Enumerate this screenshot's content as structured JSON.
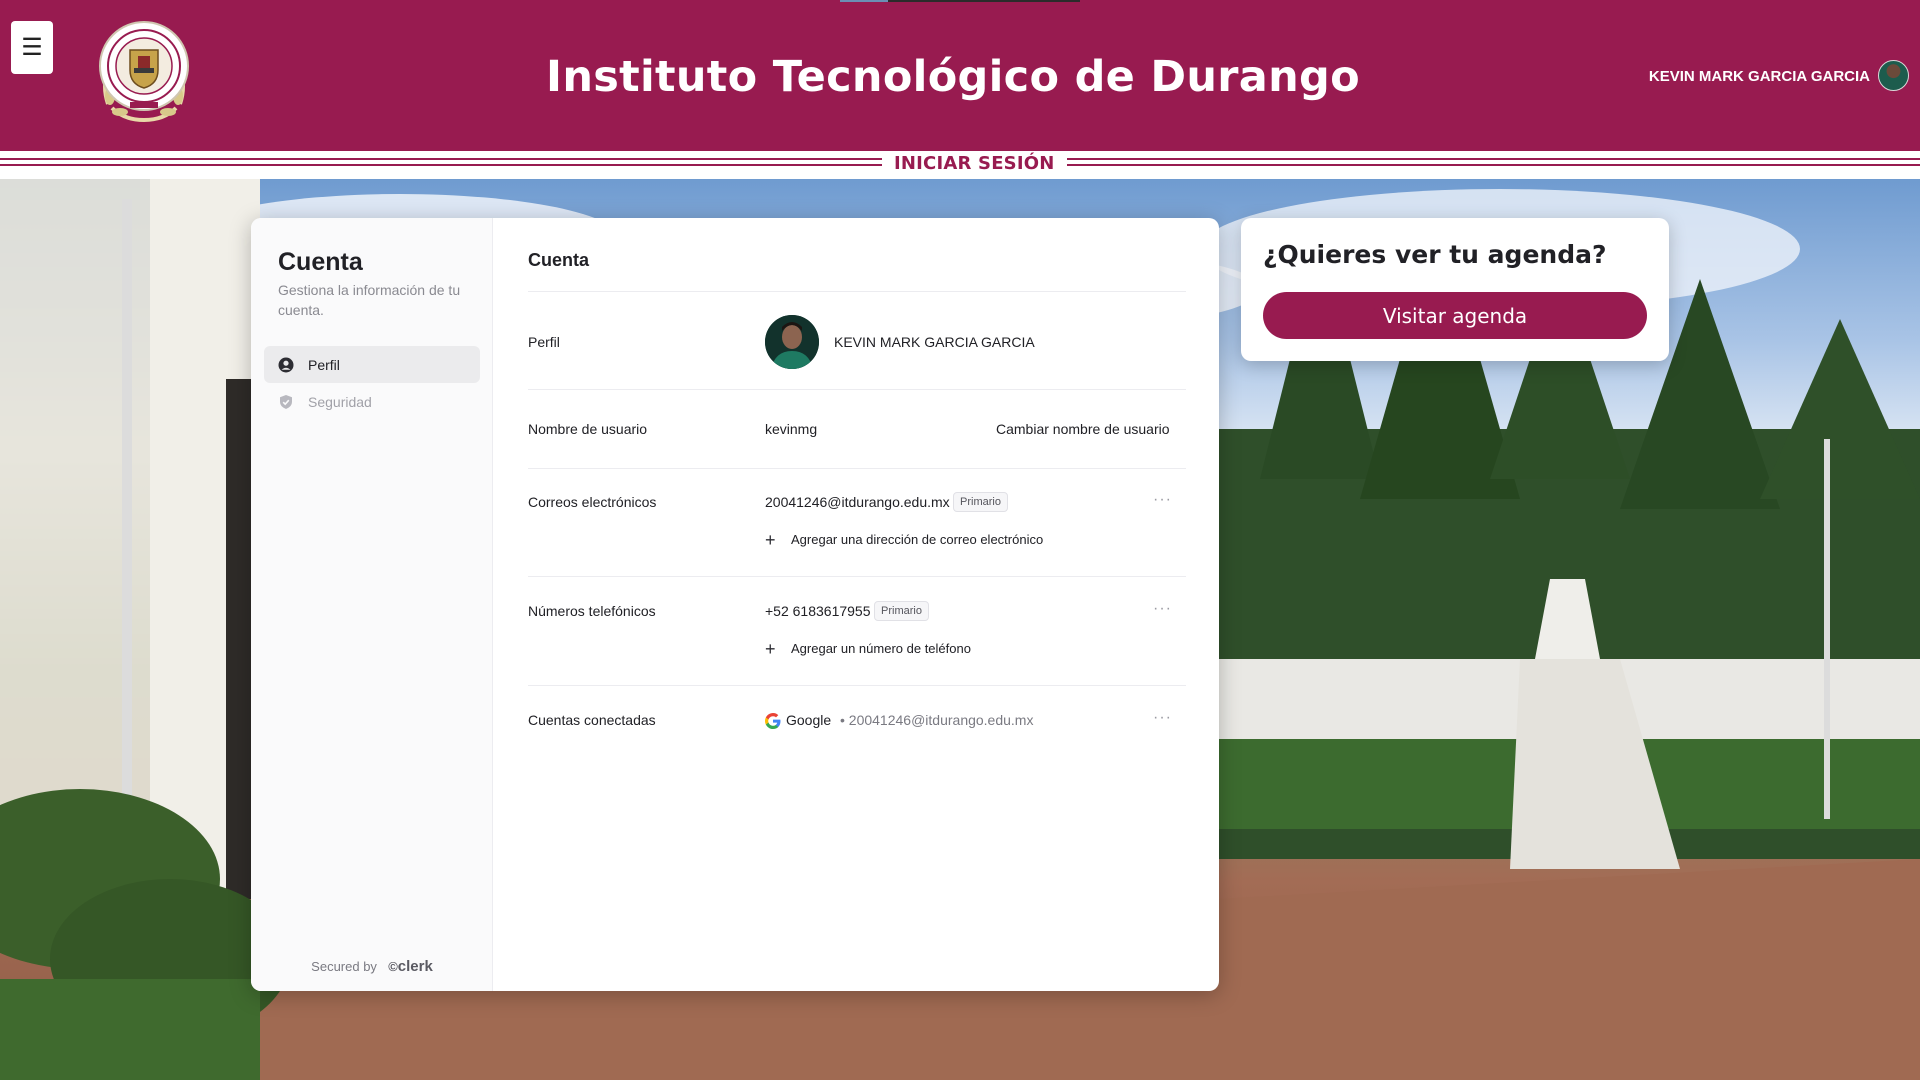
{
  "header": {
    "menu_icon": "hamburger-menu-icon",
    "menu_glyph": "☰",
    "logo_icon": "institution-seal-logo",
    "title": "Instituto Tecnológico de Durango",
    "user_name": "KEVIN MARK GARCIA GARCIA",
    "section_label": "INICIAR SESIÓN",
    "brand_color": "#981b50"
  },
  "sidebar": {
    "title": "Cuenta",
    "subtitle": "Gestiona la información de tu cuenta.",
    "items": [
      {
        "label": "Perfil",
        "icon": "user-circle-icon",
        "active": true
      },
      {
        "label": "Seguridad",
        "icon": "shield-check-icon",
        "active": false
      }
    ],
    "secured_by": "Secured by",
    "secured_brand": "clerk"
  },
  "account": {
    "title": "Cuenta",
    "profile": {
      "label": "Perfil",
      "name": "KEVIN MARK GARCIA GARCIA"
    },
    "username": {
      "label": "Nombre de usuario",
      "value": "kevinmg",
      "action": "Cambiar nombre de usuario"
    },
    "emails": {
      "label": "Correos electrónicos",
      "value": "20041246@itdurango.edu.mx",
      "badge": "Primario",
      "add": "Agregar una dirección de correo electrónico"
    },
    "phones": {
      "label": "Números telefónicos",
      "value": "+52 6183617955",
      "badge": "Primario",
      "add": "Agregar un número de teléfono"
    },
    "connected": {
      "label": "Cuentas conectadas",
      "provider": "Google",
      "provider_icon": "google-icon",
      "email": "• 20041246@itdurango.edu.mx"
    },
    "more_glyph": "···"
  },
  "agenda": {
    "title": "¿Quieres ver tu agenda?",
    "button": "Visitar agenda"
  }
}
